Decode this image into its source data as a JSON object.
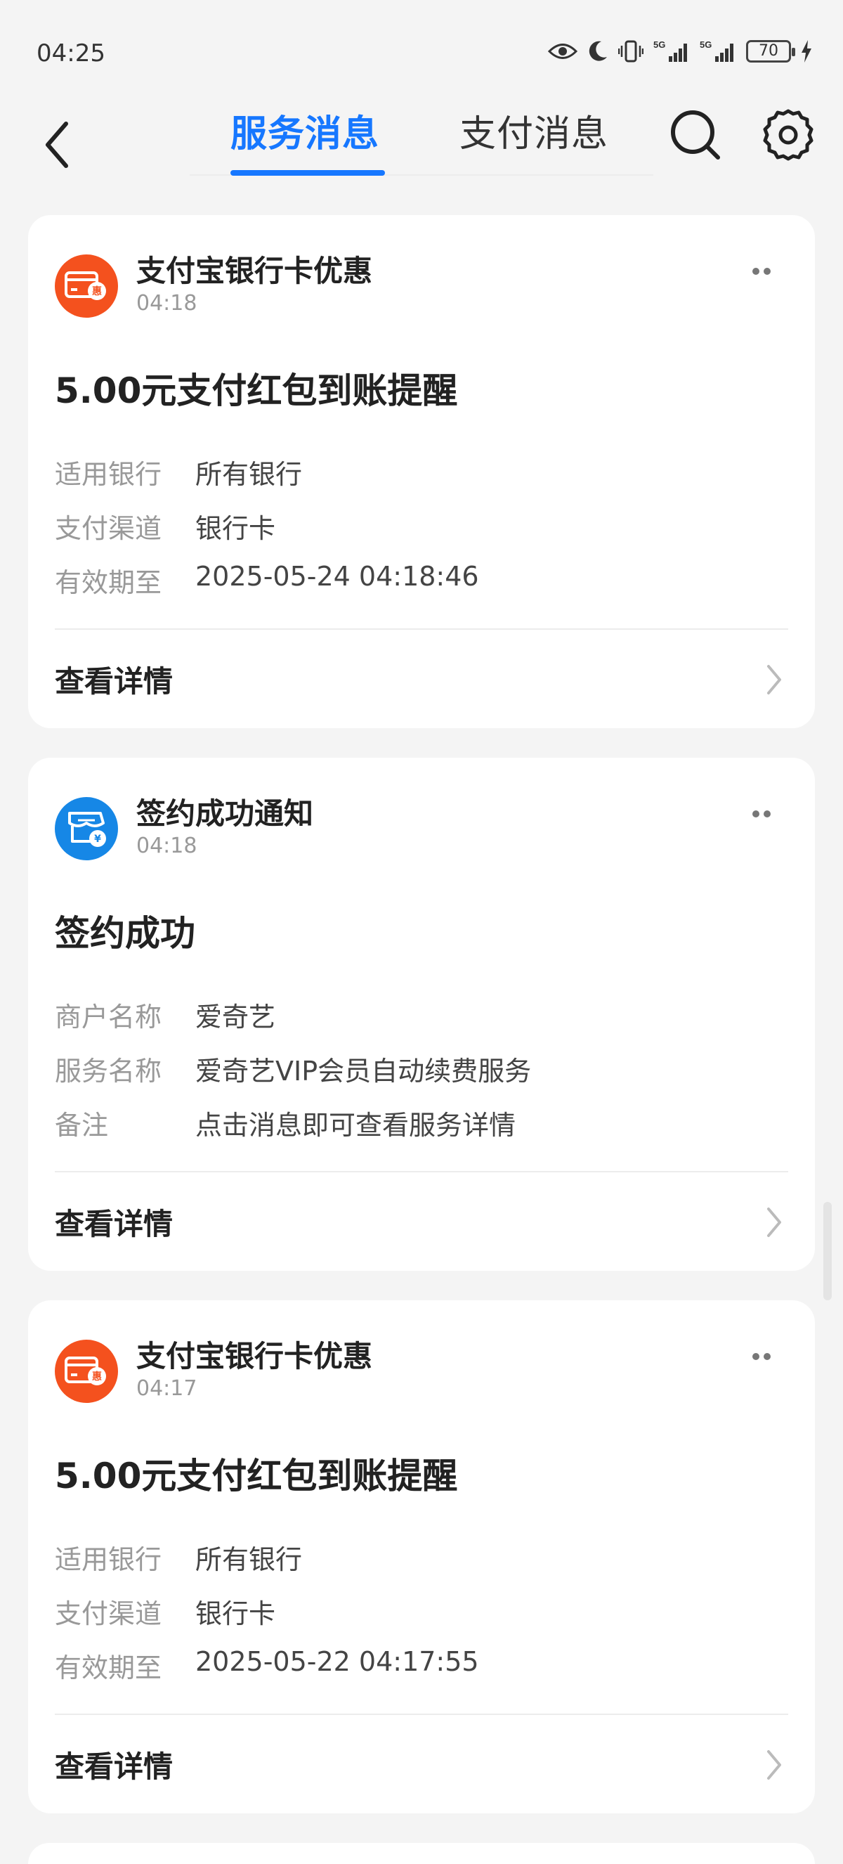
{
  "status_bar": {
    "time": "04:25",
    "battery": "70",
    "signal_labels": [
      "5G",
      "5G"
    ]
  },
  "header": {
    "tabs": [
      {
        "label": "服务消息",
        "active": true
      },
      {
        "label": "支付消息",
        "active": false
      }
    ]
  },
  "cards": [
    {
      "icon": "card-hui-icon",
      "source": "支付宝银行卡优惠",
      "time": "04:18",
      "headline": "5.00元支付红包到账提醒",
      "rows": [
        {
          "label": "适用银行",
          "value": "所有银行"
        },
        {
          "label": "支付渠道",
          "value": "银行卡"
        },
        {
          "label": "有效期至",
          "value": "2025-05-24 04:18:46"
        }
      ],
      "link": "查看详情"
    },
    {
      "icon": "store-yen-icon",
      "source": "签约成功通知",
      "time": "04:18",
      "headline": "签约成功",
      "rows": [
        {
          "label": "商户名称",
          "value": "爱奇艺"
        },
        {
          "label": "服务名称",
          "value": "爱奇艺VIP会员自动续费服务"
        },
        {
          "label": "备注",
          "value": "点击消息即可查看服务详情"
        }
      ],
      "link": "查看详情"
    },
    {
      "icon": "card-hui-icon",
      "source": "支付宝银行卡优惠",
      "time": "04:17",
      "headline": "5.00元支付红包到账提醒",
      "rows": [
        {
          "label": "适用银行",
          "value": "所有银行"
        },
        {
          "label": "支付渠道",
          "value": "银行卡"
        },
        {
          "label": "有效期至",
          "value": "2025-05-22 04:17:55"
        }
      ],
      "link": "查看详情"
    }
  ],
  "colors": {
    "accent": "#1677ff",
    "orange_icon": "#f4511e",
    "blue_icon": "#1687e6"
  }
}
